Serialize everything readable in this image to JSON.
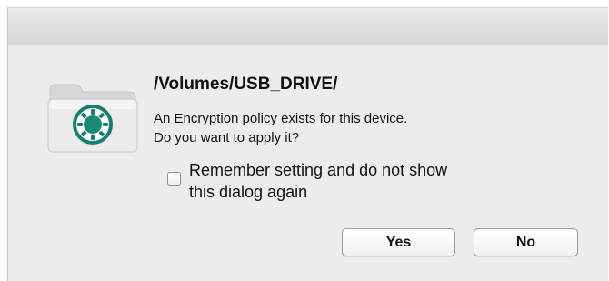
{
  "dialog": {
    "path_title": "/Volumes/USB_DRIVE/",
    "message_line1": "An Encryption policy exists for this device.",
    "message_line2": "Do you want to apply it?",
    "remember_line1": "Remember setting and do not show",
    "remember_line2": "this dialog again",
    "remember_checked": false,
    "yes_label": "Yes",
    "no_label": "No",
    "icon": "encrypted-folder-icon",
    "accent_color": "#1f8f7a"
  }
}
